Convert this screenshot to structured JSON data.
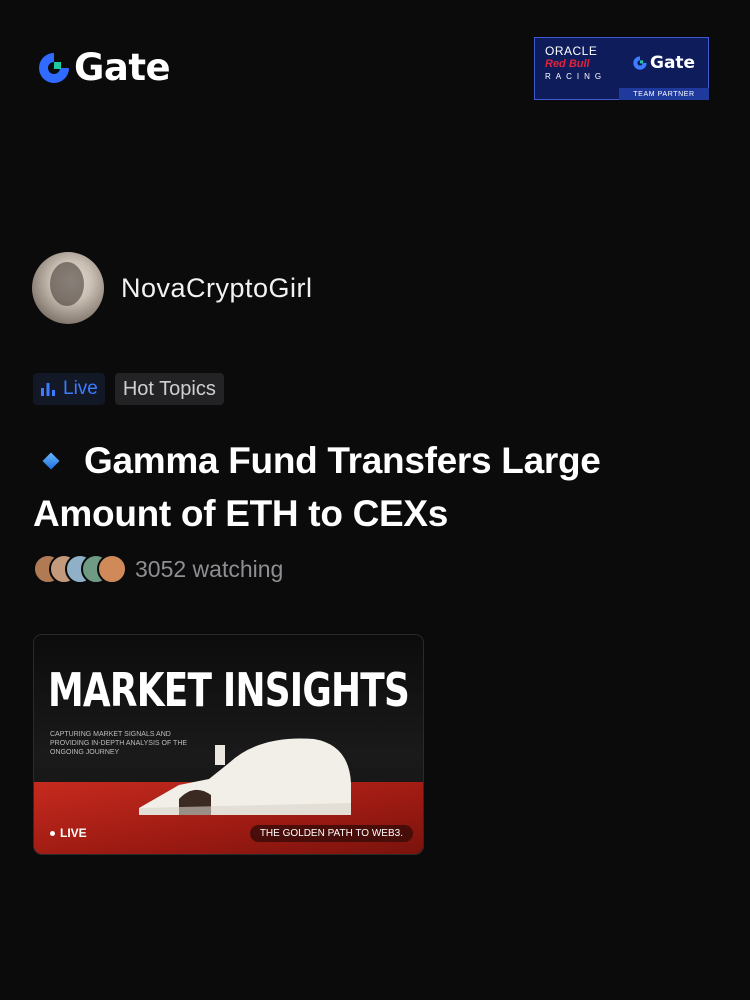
{
  "brand": {
    "logo_text": "Gate",
    "logo_color": "#1ec8a0",
    "logo_accent": "#2f6bff"
  },
  "partner_badge": {
    "line1": "ORACLE",
    "line2": "Red Bull",
    "line3": "RACING",
    "brand": "Gate",
    "footer": "TEAM PARTNER"
  },
  "author": {
    "name": "NovaCryptoGirl",
    "avatar": "avatar-photo"
  },
  "tags": {
    "live_label": "Live",
    "live_icon": "bar-chart-icon",
    "hot_label": "Hot Topics"
  },
  "post": {
    "title": "Gamma Fund Transfers Large Amount of ETH to CEXs",
    "title_icon": "blue-diamond-icon",
    "watching_text": "3052 watching",
    "viewer_avatar_count": 5
  },
  "stream_card": {
    "title": "MARKET INSIGHTS",
    "subtitle": "CAPTURING MARKET SIGNALS AND PROVIDING IN-DEPTH ANALYSIS OF THE ONGOING JOURNEY",
    "live_label": "LIVE",
    "tagline": "THE GOLDEN PATH TO WEB3."
  }
}
